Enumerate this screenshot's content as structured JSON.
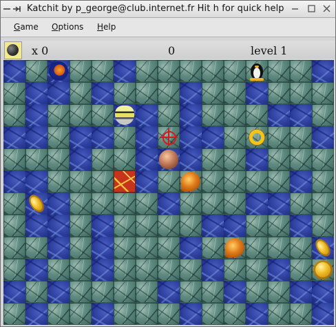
{
  "window": {
    "title": "Katchit by p_george@club.internet.fr    Hit h for quick help",
    "controls": [
      "minimize-icon",
      "maximize-icon",
      "close-icon"
    ]
  },
  "menu": {
    "game_prefix": "",
    "game_mnemonic": "G",
    "game_rest": "ame",
    "options_mnemonic": "O",
    "options_rest": "ptions",
    "help_mnemonic": "H",
    "help_rest": "elp"
  },
  "status": {
    "bomb_icon": "bomb-icon",
    "bomb_count": "x 0",
    "score": "0",
    "level": "level 1"
  },
  "board": {
    "columns": 15,
    "rows": 12,
    "legend": {
      "S": "stone",
      "W": "water",
      "L": "lava"
    },
    "grid": [
      "WSWSSWSSSSSSSSW",
      "SWWSWSSSWSSWSSS",
      "SWSSSWWSWSSSWWS",
      "WWSWWSWSWWSSSSW",
      "SSSWSSWWWSSWSSS",
      "WWSSSLWSSSSSSWS",
      "SWWSSSSWSSSWWSS",
      "SWWSWSSSSWWSSWS",
      "SSWSWSSSWSSSSSW",
      "SWSSWSSSSWSSWSS",
      "WSWSSSSWSSWSSWW",
      "SWSSWSSSWSSWSSW"
    ],
    "sprites": [
      {
        "kind": "globe",
        "col": 2,
        "row": 0
      },
      {
        "kind": "penguin",
        "col": 11,
        "row": 0
      },
      {
        "kind": "bee",
        "col": 5,
        "row": 2
      },
      {
        "kind": "crosshair",
        "col": 7,
        "row": 3
      },
      {
        "kind": "fishring",
        "col": 11,
        "row": 3
      },
      {
        "kind": "onion",
        "col": 7,
        "row": 4
      },
      {
        "kind": "leaf",
        "col": 8,
        "row": 5
      },
      {
        "kind": "coin-tilt",
        "col": 1,
        "row": 6
      },
      {
        "kind": "leaf",
        "col": 10,
        "row": 8
      },
      {
        "kind": "coin-tilt",
        "col": 14,
        "row": 8
      },
      {
        "kind": "coin",
        "col": 14,
        "row": 9
      }
    ]
  }
}
